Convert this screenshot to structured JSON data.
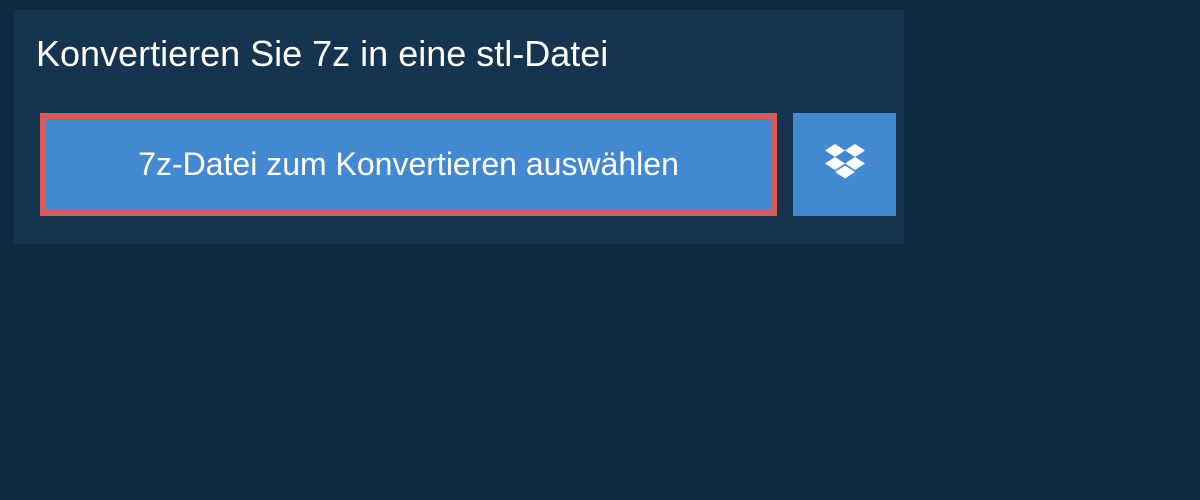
{
  "heading": {
    "title": "Konvertieren Sie 7z in eine stl-Datei"
  },
  "buttons": {
    "select_file_label": "7z-Datei zum Konvertieren auswählen",
    "dropbox_icon_name": "dropbox-icon"
  },
  "colors": {
    "background": "#0f2942",
    "panel": "#14344f",
    "button_bg": "#4289d2",
    "highlight_border": "#dc5a56",
    "text": "#ffffff"
  }
}
